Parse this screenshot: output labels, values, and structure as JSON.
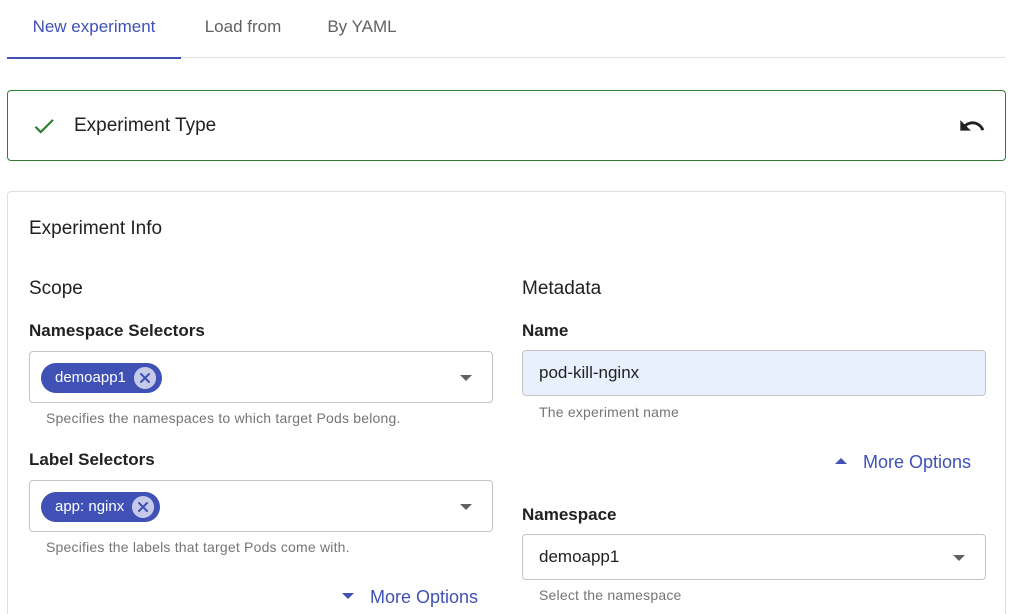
{
  "tabs": [
    {
      "label": "New experiment",
      "active": true
    },
    {
      "label": "Load from",
      "active": false
    },
    {
      "label": "By YAML",
      "active": false
    }
  ],
  "experiment_type": {
    "title": "Experiment Type",
    "status_icon": "check-icon",
    "action_icon": "undo-icon",
    "status_color": "#2e7d32"
  },
  "experiment_info": {
    "title": "Experiment Info",
    "scope": {
      "title": "Scope",
      "namespace_selectors": {
        "label": "Namespace Selectors",
        "chips": [
          "demoapp1"
        ],
        "helper": "Specifies the namespaces to which target Pods belong."
      },
      "label_selectors": {
        "label": "Label Selectors",
        "chips": [
          "app: nginx"
        ],
        "helper": "Specifies the labels that target Pods come with."
      },
      "more_options": "More Options"
    },
    "metadata": {
      "title": "Metadata",
      "name": {
        "label": "Name",
        "value": "pod-kill-nginx",
        "helper": "The experiment name"
      },
      "more_options": "More Options",
      "namespace": {
        "label": "Namespace",
        "value": "demoapp1",
        "helper": "Select the namespace"
      }
    }
  },
  "colors": {
    "accent": "#3f51b5",
    "success": "#2e7d32",
    "input_fill": "#e8f0fe"
  }
}
